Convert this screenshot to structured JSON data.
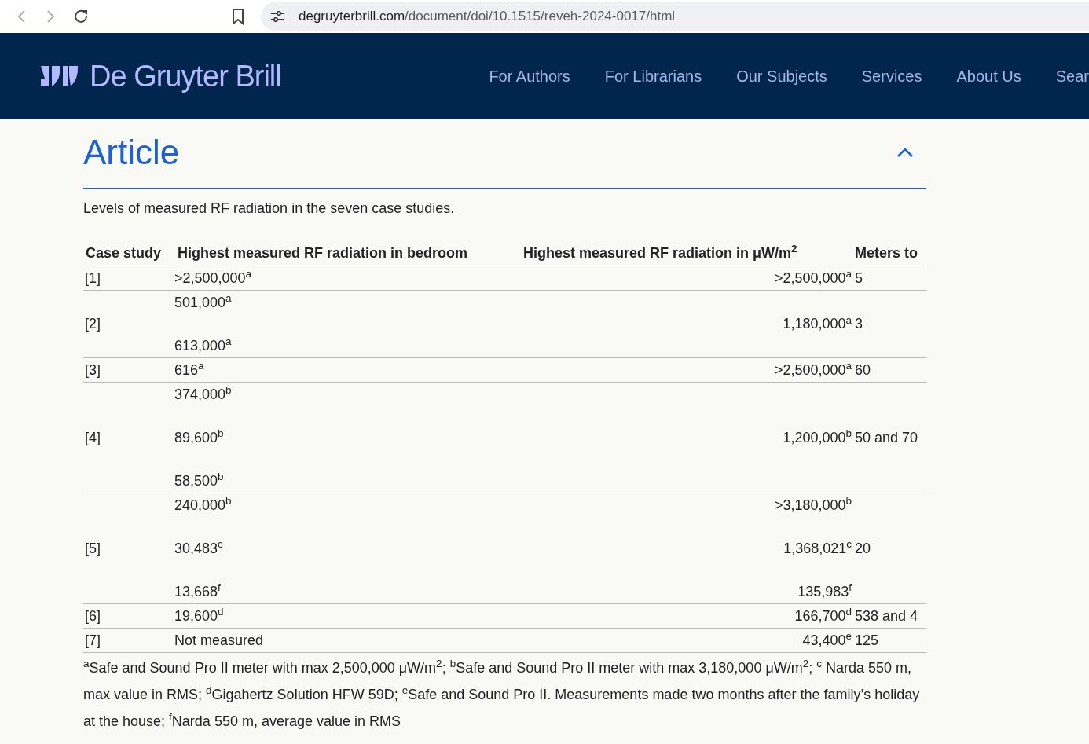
{
  "browser": {
    "url_domain": "degruyterbrill.com",
    "url_path": "/document/doi/10.1515/reveh-2024-0017/html"
  },
  "site": {
    "logo": "De Gruyter Brill",
    "nav": [
      "For Authors",
      "For Librarians",
      "Our Subjects",
      "Services",
      "About Us",
      "Sear"
    ]
  },
  "section": {
    "title": "Article",
    "expanded": true
  },
  "caption": "Levels of measured RF radiation in the seven case studies.",
  "table": {
    "columns": [
      "Case study",
      "Highest measured RF radiation in bedroom",
      "Highest measured RF radiation in μW/m$^{2}$",
      "Meters to"
    ],
    "rows": [
      {
        "case": "[1]",
        "bedroom": [
          ">2,500,000$^{a}$"
        ],
        "highest": [
          ">2,500,000$^{a}$"
        ],
        "meters": "5"
      },
      {
        "case": "[2]",
        "bedroom": [
          "501,000$^{a}$",
          "613,000$^{a}$"
        ],
        "highest": [
          "1,180,000$^{a}$"
        ],
        "meters": "3"
      },
      {
        "case": "[3]",
        "bedroom": [
          "616$^{a}$"
        ],
        "highest": [
          ">2,500,000$^{a}$"
        ],
        "meters": "60"
      },
      {
        "case": "[4]",
        "bedroom": [
          "374,000$^{b}$",
          "89,600$^{b}$",
          "58,500$^{b}$"
        ],
        "highest": [
          "1,200,000$^{b}$"
        ],
        "meters": "50 and 70"
      },
      {
        "case": "[5]",
        "bedroom": [
          "240,000$^{b}$",
          "30,483$^{c}$",
          "13,668$^{f}$"
        ],
        "highest": [
          ">3,180,000$^{b}$",
          "1,368,021$^{c}$",
          "135,983$^{f}$"
        ],
        "meters": "20"
      },
      {
        "case": "[6]",
        "bedroom": [
          "19,600$^{d}$"
        ],
        "highest": [
          "166,700$^{d}$"
        ],
        "meters": "538 and 4"
      },
      {
        "case": "[7]",
        "bedroom": [
          "Not measured"
        ],
        "highest": [
          "43,400$^{e}$"
        ],
        "meters": "125"
      }
    ]
  },
  "footnote": "$^{a}$Safe and Sound Pro II meter with max 2,500,000 μW/m$^{2}$; $^{b}$Safe and Sound Pro II meter with max 3,180,000 μW/m$^{2}$; $^{c}$ Narda 550 m, max value in RMS; $^{d}$Gigahertz Solution HFW 59D; $^{e}$Safe and Sound Pro II. Measurements made two months after the family’s holiday at the house; $^{f}$Narda 550 m, average value in RMS"
}
